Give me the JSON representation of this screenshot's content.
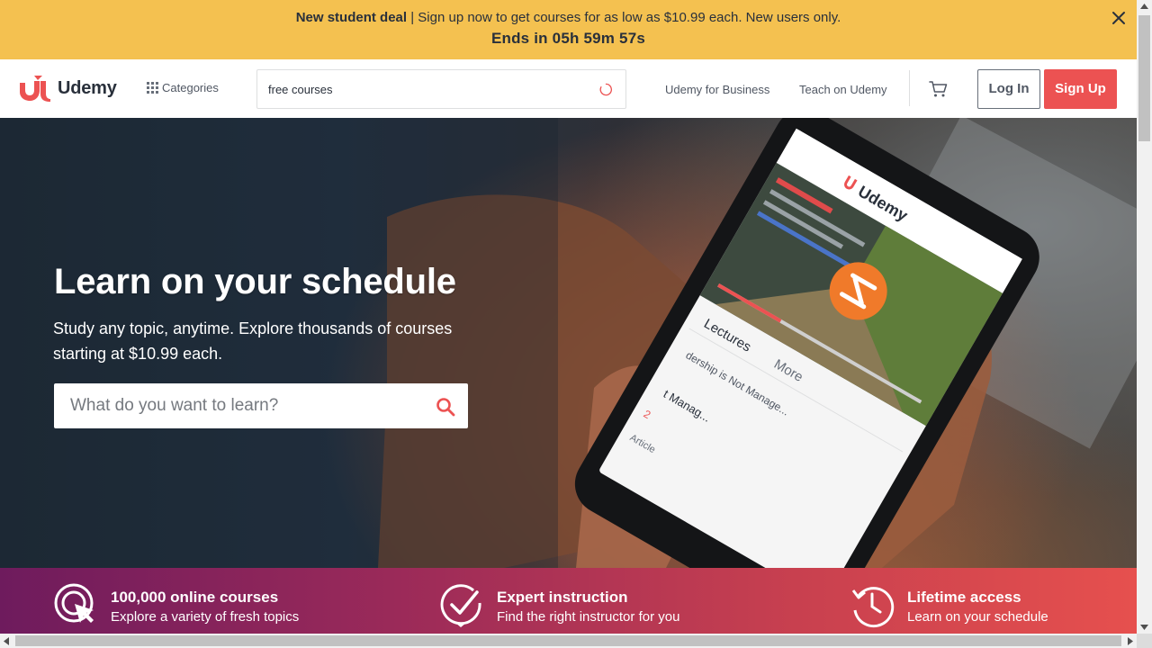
{
  "promo": {
    "deal_label": "New student deal",
    "separator": " | ",
    "message": "Sign up now to get courses for as low as $10.99 each. New users only.",
    "countdown": "Ends in 05h 59m 57s",
    "background": "#f4c150"
  },
  "header": {
    "brand": "Udemy",
    "brand_color": "#ec5252",
    "categories_label": "Categories",
    "search_value": "free courses",
    "links": {
      "business": "Udemy for Business",
      "teach": "Teach on Udemy"
    },
    "login_label": "Log In",
    "signup_label": "Sign Up"
  },
  "hero": {
    "title": "Learn on your schedule",
    "subtitle": "Study any topic, anytime. Explore thousands of courses starting at $10.99 each.",
    "search_placeholder": "What do you want to learn?",
    "phone_screen": {
      "brand": "Udemy",
      "tab_lectures": "Lectures",
      "tab_more": "More",
      "lecture_line1": "dership is Not Manage...",
      "lecture_line2": "t Manag...",
      "count": "2",
      "item": "Article"
    }
  },
  "values": [
    {
      "icon": "target-cursor-icon",
      "title": "100,000 online courses",
      "subtitle": "Explore a variety of fresh topics"
    },
    {
      "icon": "check-badge-icon",
      "title": "Expert instruction",
      "subtitle": "Find the right instructor for you"
    },
    {
      "icon": "clock-history-icon",
      "title": "Lifetime access",
      "subtitle": "Learn on your schedule"
    }
  ],
  "colors": {
    "accent": "#ec5252",
    "gradient_start": "#6e1b5d",
    "gradient_end": "#e6504e"
  }
}
